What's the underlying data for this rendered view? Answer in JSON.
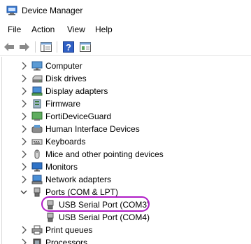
{
  "window": {
    "title": "Device Manager"
  },
  "menu": [
    "File",
    "Action",
    "View",
    "Help"
  ],
  "tree": {
    "categories": [
      {
        "label": "Computer",
        "icon": "computer-icon"
      },
      {
        "label": "Disk drives",
        "icon": "disk-drive-icon"
      },
      {
        "label": "Display adapters",
        "icon": "display-adapter-icon"
      },
      {
        "label": "Firmware",
        "icon": "firmware-icon"
      },
      {
        "label": "FortiDeviceGuard",
        "icon": "device-icon"
      },
      {
        "label": "Human Interface Devices",
        "icon": "hid-icon"
      },
      {
        "label": "Keyboards",
        "icon": "keyboard-icon"
      },
      {
        "label": "Mice and other pointing devices",
        "icon": "mouse-icon"
      },
      {
        "label": "Monitors",
        "icon": "monitor-icon"
      },
      {
        "label": "Network adapters",
        "icon": "network-adapter-icon"
      },
      {
        "label": "Ports (COM & LPT)",
        "icon": "port-icon",
        "expanded": true
      },
      {
        "label": "Print queues",
        "icon": "printer-icon"
      },
      {
        "label": "Processors",
        "icon": "processor-icon"
      }
    ],
    "ports_children": [
      {
        "label": "USB Serial Port (COM3)",
        "icon": "usb-serial-port-icon",
        "highlighted": true
      },
      {
        "label": "USB Serial Port (COM4)",
        "icon": "usb-serial-port-icon"
      }
    ]
  },
  "colors": {
    "highlight": "#b01cc7",
    "accent": "#1f5fbf"
  }
}
